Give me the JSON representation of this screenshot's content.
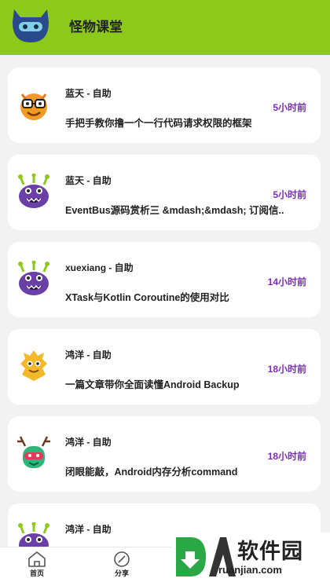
{
  "header": {
    "title": "怪物课堂"
  },
  "posts": [
    {
      "author": "蓝天 - 自助",
      "time": "5小时前",
      "title": "手把手教你撸一个一行代码请求权限的框架",
      "avatar": "orange-monster-with-glasses"
    },
    {
      "author": "蓝天 - 自助",
      "time": "5小时前",
      "title": "EventBus源码赏析三 &mdash;&mdash; 订阅信..",
      "avatar": "purple-monster"
    },
    {
      "author": "xuexiang - 自助",
      "time": "14小时前",
      "title": "XTask与Kotlin Coroutine的使用对比",
      "avatar": "purple-monster"
    },
    {
      "author": "鸿洋 - 自助",
      "time": "18小时前",
      "title": "一篇文章带你全面读懂Android Backup",
      "avatar": "yellow-spiky-monster"
    },
    {
      "author": "鸿洋 - 自助",
      "time": "18小时前",
      "title": "闭眼能敲，Android内存分析command",
      "avatar": "green-antler-monster"
    },
    {
      "author": "鸿洋 - 自助",
      "time": "",
      "title": "",
      "avatar": "purple-monster"
    }
  ],
  "tabbar": {
    "home_label": "首页",
    "share_label": "分享"
  },
  "watermark": {
    "main": "软件园",
    "sub": "ruanjian.com"
  },
  "colors": {
    "header": "#8dc91a",
    "time": "#7b2fb5",
    "background": "#f2f2f2"
  }
}
